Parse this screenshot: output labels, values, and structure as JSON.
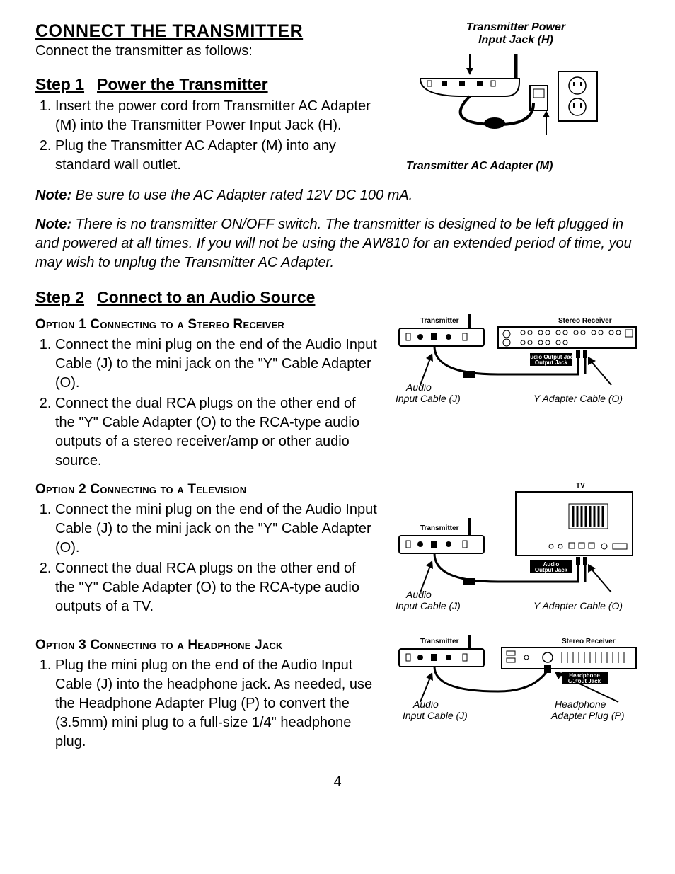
{
  "section_title": "CONNECT THE TRANSMITTER",
  "intro": "Connect the transmitter as follows:",
  "step1": {
    "label": "Step 1",
    "title": "Power the Transmitter",
    "items": [
      "Insert the power cord from Transmitter AC Adapter (M) into the Transmitter Power Input Jack (H).",
      "Plug the Transmitter AC Adapter (M) into any standard wall outlet."
    ]
  },
  "note1_label": "Note:",
  "note1_body": " Be sure to use the AC Adapter rated 12V DC 100 mA.",
  "note2_label": "Note:",
  "note2_body": " There is no transmitter ON/OFF switch. The transmitter is designed to be left plugged in and powered at all times. If you will not be using the AW810 for an extended period of time, you may wish to unplug the Transmitter AC Adapter.",
  "step2": {
    "label": "Step 2",
    "title": "Connect to an Audio Source"
  },
  "option1": {
    "title": "Option 1 Connecting to a Stereo Receiver",
    "items": [
      "Connect the mini plug on the end of the Audio Input Cable (J) to the mini jack on the \"Y\" Cable Adapter (O).",
      "Connect the dual RCA plugs on the other end of the \"Y\" Cable Adapter (O) to the RCA-type audio outputs of a stereo receiver/amp or other audio source."
    ]
  },
  "option2": {
    "title": "Option 2 Connecting to a Television",
    "items": [
      "Connect the mini plug on the end of the Audio Input Cable (J) to the mini jack on the \"Y\" Cable Adapter (O).",
      "Connect the dual RCA plugs on the other end of the \"Y\" Cable Adapter (O) to the RCA-type audio outputs of a TV."
    ]
  },
  "option3": {
    "title": "Option 3 Connecting to a Headphone Jack",
    "items": [
      "Plug the mini plug on the end of the Audio Input Cable (J) into the headphone jack. As needed, use the Headphone Adapter Plug (P) to convert the (3.5mm) mini plug to a full-size 1/4\" headphone plug."
    ]
  },
  "diagram_top": {
    "label_top": "Transmitter Power",
    "label_top2": "Input Jack (H)",
    "label_bottom": "Transmitter AC Adapter (M)"
  },
  "diagram1": {
    "transmitter": "Transmitter",
    "receiver": "Stereo Receiver",
    "audio_out": "Audio Output Jack",
    "audio_label_top": "Audio",
    "audio_label": "Input Cable (J)",
    "y_label": "Y Adapter Cable (O)"
  },
  "diagram2": {
    "transmitter": "Transmitter",
    "tv": "TV",
    "audio_out": "Audio Output Jack",
    "audio_label_top": "Audio",
    "audio_label": "Input Cable (J)",
    "y_label": "Y Adapter Cable (O)"
  },
  "diagram3": {
    "transmitter": "Transmitter",
    "receiver": "Stereo Receiver",
    "hp_out": "Headphone Output Jack",
    "audio_label_top": "Audio",
    "audio_label": "Input Cable (J)",
    "hp_label_top": "Headphone",
    "hp_label": "Adapter Plug (P)"
  },
  "page_number": "4"
}
